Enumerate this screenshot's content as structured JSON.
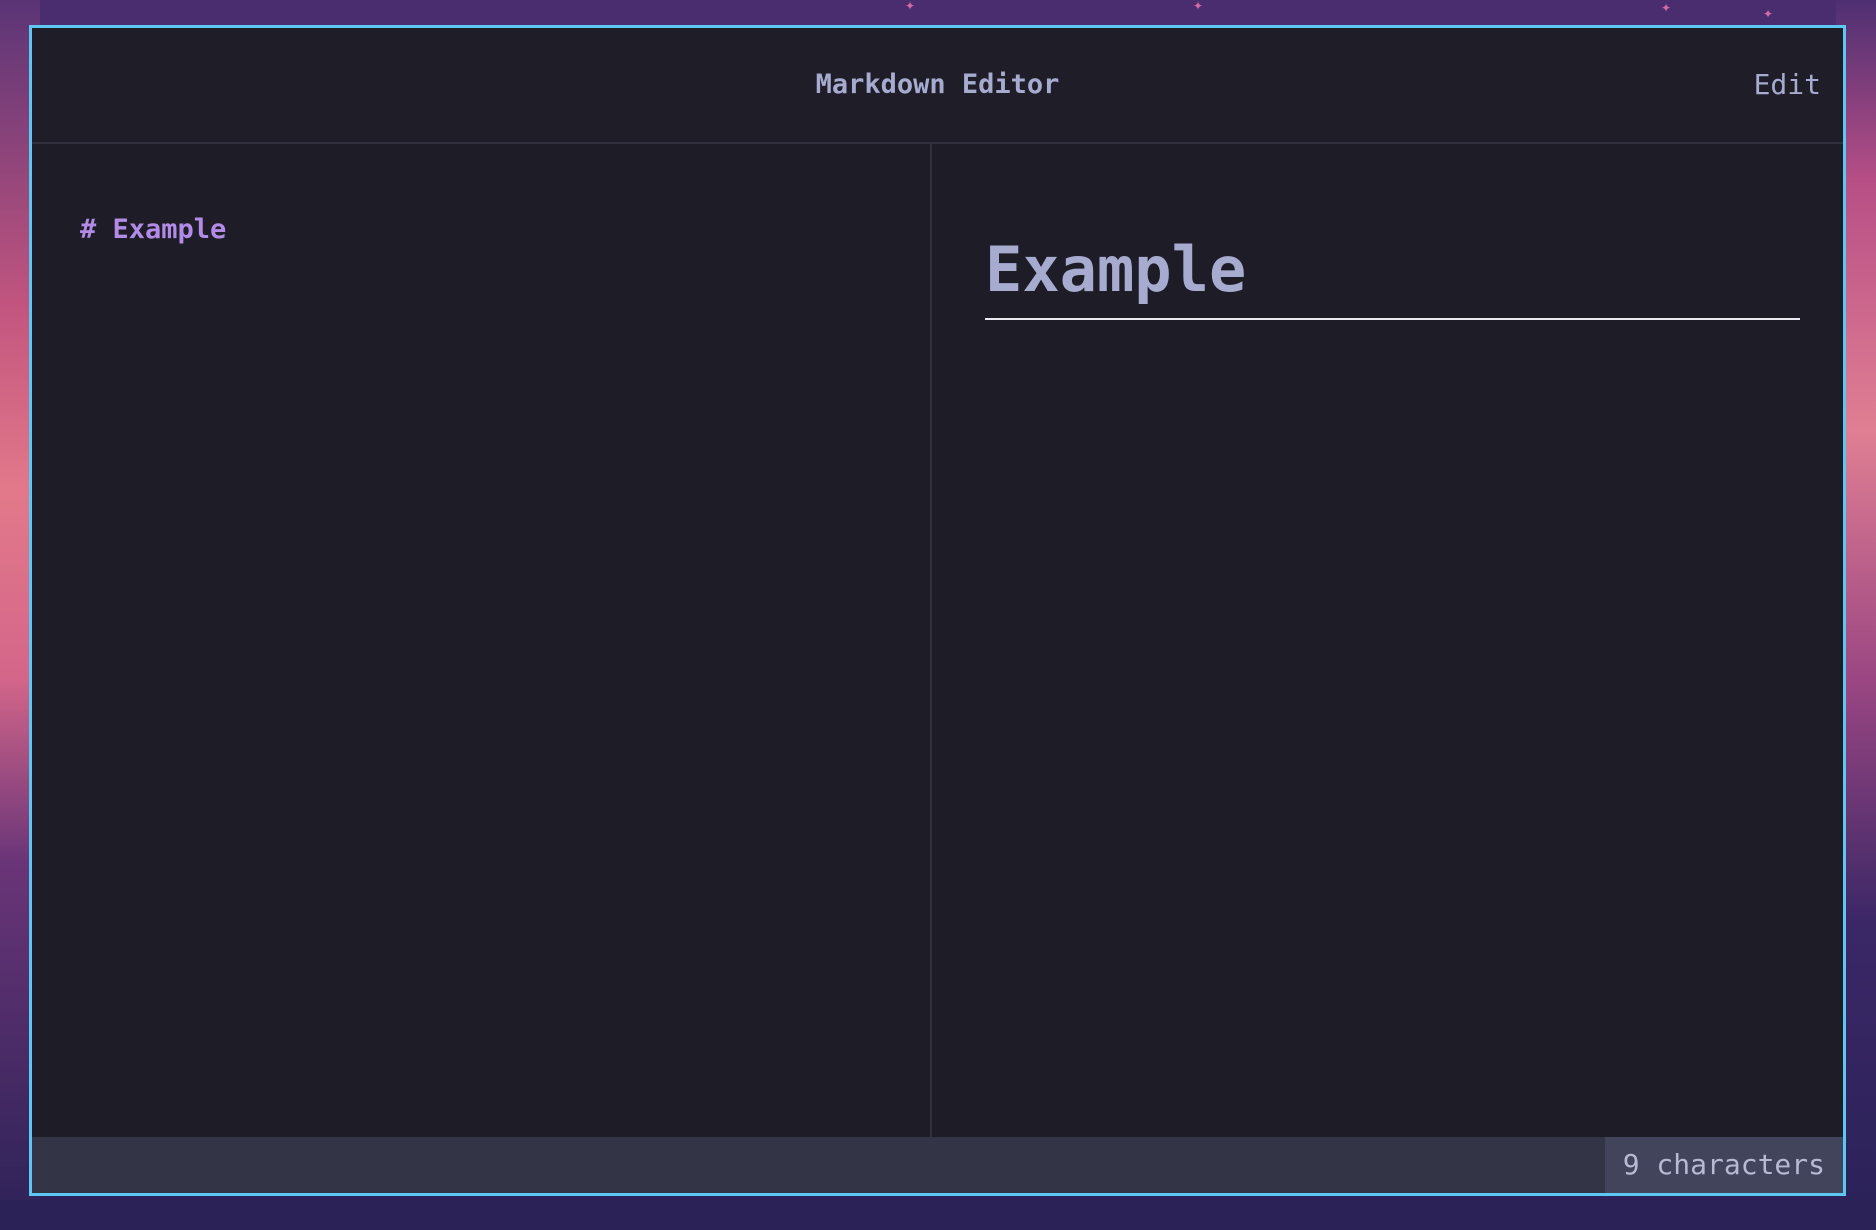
{
  "app": {
    "title": "Markdown Editor",
    "mode_label": "Edit"
  },
  "editor": {
    "content": "# Example"
  },
  "preview": {
    "heading": "Example"
  },
  "status": {
    "char_count": "9 characters"
  },
  "colors": {
    "window_border": "#5cc8f2",
    "background": "#1d1c27",
    "editor_text": "#b28be6",
    "preview_text": "#a6abcf",
    "statusbar": "#333546"
  }
}
